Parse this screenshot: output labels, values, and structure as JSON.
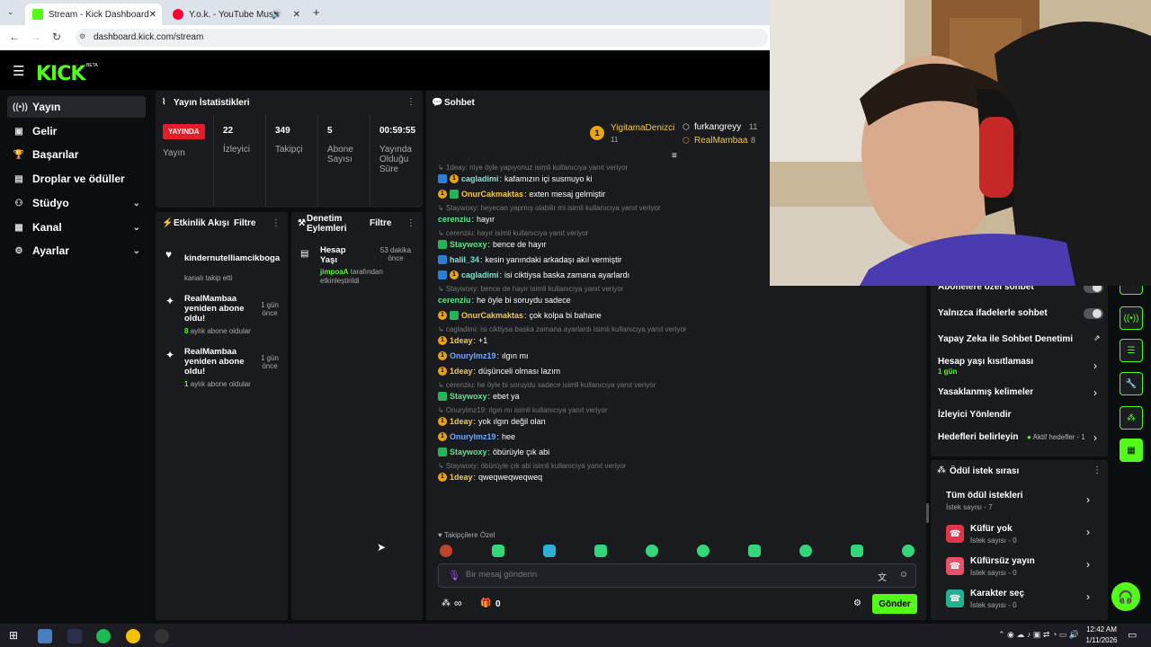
{
  "browser": {
    "tabs": [
      {
        "title": "Stream - Kick Dashboard",
        "active": true
      },
      {
        "title": "Y.o.k. - YouTube Music",
        "active": false
      }
    ],
    "url": "dashboard.kick.com/stream"
  },
  "brand": {
    "logo": "KICK",
    "beta": "BETA",
    "accent": "#53fc18"
  },
  "sidebar": {
    "items": [
      {
        "label": "Yayın",
        "icon": "broadcast-icon",
        "selected": true,
        "expandable": false
      },
      {
        "label": "Gelir",
        "icon": "revenue-icon",
        "expandable": false
      },
      {
        "label": "Başarılar",
        "icon": "trophy-icon",
        "expandable": false
      },
      {
        "label": "Droplar ve ödüller",
        "icon": "gift-icon",
        "expandable": false
      },
      {
        "label": "Stüdyo",
        "icon": "studio-icon",
        "expandable": true
      },
      {
        "label": "Kanal",
        "icon": "channel-icon",
        "expandable": true
      },
      {
        "label": "Ayarlar",
        "icon": "settings-icon",
        "expandable": true
      }
    ]
  },
  "stats": {
    "title": "Yayın İstatistikleri",
    "live_label": "YAYINDA",
    "live_sub": "Yayın",
    "items": [
      {
        "value": "22",
        "label": "İzleyici"
      },
      {
        "value": "349",
        "label": "Takipçi"
      },
      {
        "value": "5",
        "label": "Abone Sayısı"
      },
      {
        "value": "00:59:55",
        "label": "Yayında Olduğu Süre"
      }
    ]
  },
  "activity": {
    "title": "Etkinlik Akışı",
    "filter": "Filtre",
    "items": [
      {
        "name": "kindernutelliamcikboga",
        "sub": "kanalı takip etti",
        "time": ""
      },
      {
        "name": "RealMambaa yeniden abone oldu!",
        "sub_count": "8",
        "sub": "aylık abone oldular",
        "time": "1 gün önce"
      },
      {
        "name": "RealMambaa yeniden abone oldu!",
        "sub_count": "1",
        "sub": "aylık abone oldular",
        "time": "1 gün önce"
      }
    ]
  },
  "audit": {
    "title": "Denetim Eylemleri",
    "filter": "Filtre",
    "items": [
      {
        "title": "Hesap Yaşı",
        "time": "53 dakika önce",
        "actor": "jimpoaA",
        "text": "tarafından etkinleştirildi"
      }
    ]
  },
  "chat": {
    "title": "Sohbet",
    "pinned": [
      {
        "name": "YigitamaDenizci",
        "count": "11"
      },
      {
        "name": "furkangreyy",
        "count": "11"
      },
      {
        "name": "RealMambaa",
        "count": "8"
      }
    ],
    "lines": [
      {
        "reply": "1deay: niye öyle yapıyonuz isimli kullanıcıya yanıt veriyor"
      },
      {
        "badges": [
          "blue",
          "gold"
        ],
        "user": "cagladimi",
        "color": "u-c",
        "text": "kafamızın içi susmuyo ki"
      },
      {
        "badges": [
          "gold",
          "green"
        ],
        "user": "OnurCakmaktas",
        "color": "u-y",
        "text": "exten mesaj gelmiştir"
      },
      {
        "reply": "Staywoxy: heyecan yapmış olabilir mi isimli kullanıcıya yanıt veriyor"
      },
      {
        "badges": [],
        "user": "cerenziu",
        "color": "u-g",
        "text": "hayır"
      },
      {
        "reply": "cerenziu: hayır isimli kullanıcıya yanıt veriyor"
      },
      {
        "badges": [
          "green"
        ],
        "user": "Staywoxy",
        "color": "u-g",
        "text": "bence de hayır"
      },
      {
        "badges": [
          "blue"
        ],
        "user": "halil_34",
        "color": "u-c",
        "text": "kesin yanındaki arkadaşı akıl vermiştir"
      },
      {
        "badges": [
          "blue",
          "gold"
        ],
        "user": "cagladimi",
        "color": "u-c",
        "text": "isi ciktiysa baska zamana ayarlardı"
      },
      {
        "reply": "Staywoxy: bence de hayır isimli kullanıcıya yanıt veriyor"
      },
      {
        "badges": [],
        "user": "cerenziu",
        "color": "u-g",
        "text": "he öyle bi soruydu sadece"
      },
      {
        "badges": [
          "gold",
          "green"
        ],
        "user": "OnurCakmaktas",
        "color": "u-y",
        "text": "çok kolpa bi bahane"
      },
      {
        "reply": "cagladimi: isi ciktiysa baska zamana ayarlardı isimli kullanıcıya yanıt veriyor"
      },
      {
        "badges": [
          "gold"
        ],
        "user": "1deay",
        "color": "u-y",
        "text": "+1"
      },
      {
        "badges": [
          "gold"
        ],
        "user": "Onurylmz19",
        "color": "u-b",
        "text": "ılgın mı"
      },
      {
        "badges": [
          "gold"
        ],
        "user": "1deay",
        "color": "u-y",
        "text": "düşünceli olması lazım"
      },
      {
        "reply": "cerenziu: he öyle bi soruydu sadece isimli kullanıcıya yanıt veriyor"
      },
      {
        "badges": [
          "green"
        ],
        "user": "Staywoxy",
        "color": "u-g",
        "text": "ebet ya"
      },
      {
        "reply": "Onurylmz19: ılgın mı isimli kullanıcıya yanıt veriyor"
      },
      {
        "badges": [
          "gold"
        ],
        "user": "1deay",
        "color": "u-y",
        "text": "yok ılgın değil olan"
      },
      {
        "badges": [
          "gold"
        ],
        "user": "Onurylmz19",
        "color": "u-b",
        "text": "hee"
      },
      {
        "badges": [
          "green"
        ],
        "user": "Staywoxy",
        "color": "u-g",
        "text": "öbürüyle çık abi"
      },
      {
        "reply": "Staywoxy: öbürüyle çık abi isimli kullanıcıya yanıt veriyor"
      },
      {
        "badges": [
          "gold"
        ],
        "user": "1deay",
        "color": "u-y",
        "text": "qweqweqweqweq"
      }
    ],
    "followers_only": "Takipçilere Özel",
    "input_placeholder": "Bir mesaj gönderin",
    "points": "∞",
    "gift_count": "0",
    "send": "Gönder"
  },
  "chat_settings": {
    "rows": [
      {
        "label": "Abonelere özel sohbet",
        "type": "toggle"
      },
      {
        "label": "Yalnızca ifadelerle sohbet",
        "type": "toggle"
      },
      {
        "label": "Yapay Zeka ile Sohbet Denetimi",
        "type": "link"
      },
      {
        "label": "Hesap yaşı kısıtlaması",
        "sub": "1 gün",
        "type": "arrow"
      },
      {
        "label": "Yasaklanmış kelimeler",
        "type": "arrow"
      },
      {
        "label": "İzleyici Yönlendir",
        "type": "none"
      },
      {
        "label": "Hedefleri belirleyin",
        "status": "Aktif hedefler - 1",
        "type": "arrow"
      }
    ]
  },
  "rewards": {
    "title": "Ödül istek sırası",
    "items": [
      {
        "title": "Tüm ödül istekleri",
        "sub": "İstek sayısı - 7",
        "color": ""
      },
      {
        "title": "Küfür yok",
        "sub": "İstek sayısı - 0",
        "color": "#e5334b"
      },
      {
        "title": "Küfürsüz yayın",
        "sub": "İstek sayısı - 0",
        "color": "#e8506b"
      },
      {
        "title": "Karakter seç",
        "sub": "İstek sayısı - 0",
        "color": "#1fb38f"
      }
    ]
  },
  "taskbar": {
    "time": "12:42 AM",
    "date": "1/11/2026"
  }
}
